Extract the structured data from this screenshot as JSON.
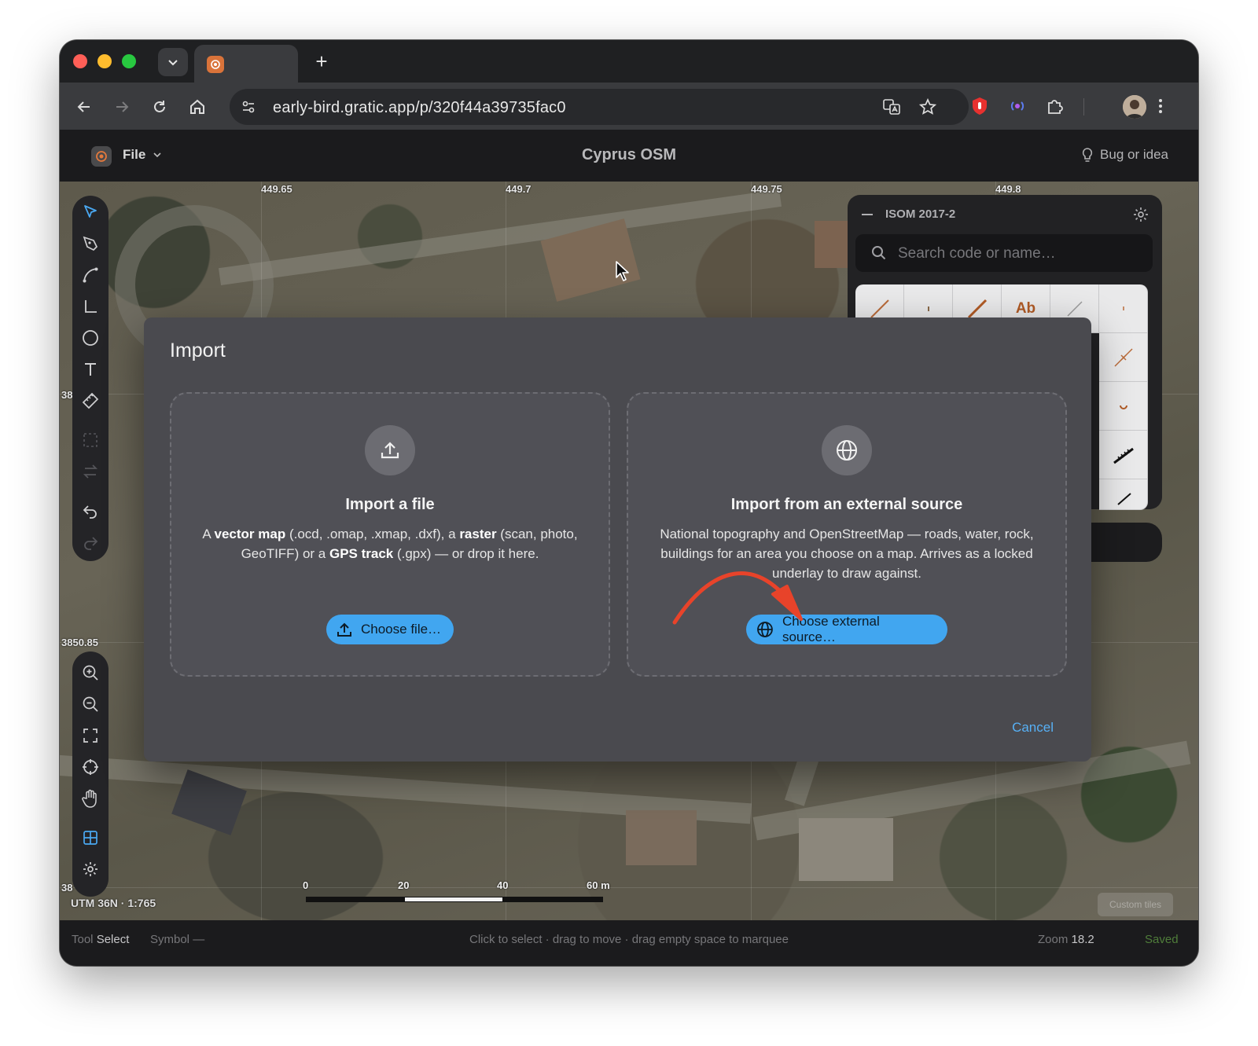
{
  "browser": {
    "url": "early-bird.gratic.app/p/320f44a39735fac0"
  },
  "app": {
    "file_menu": "File",
    "doc_title": "Cyprus OSM",
    "bug_link": "Bug or idea"
  },
  "map": {
    "coords_top": [
      "449.65",
      "449.7",
      "449.75",
      "449.8"
    ],
    "coord_left_1": "38",
    "coord_left_2": "3850.85",
    "coord_left_3": "38",
    "projection": "UTM 36N · 1:765",
    "scale_labels": [
      "0",
      "20",
      "40",
      "60 m"
    ],
    "custom_chip": "Custom tiles"
  },
  "palette": {
    "title": "ISOM 2017-2",
    "search_placeholder": "Search code or name…",
    "text_symbol": "Ab"
  },
  "dialog": {
    "title": "Import",
    "file_card": {
      "title": "Import a file",
      "desc_1": "A ",
      "desc_b1": "vector map",
      "desc_2": " (.ocd, .omap, .xmap, .dxf), a ",
      "desc_b2": "raster",
      "desc_3": " (scan, photo, GeoTIFF) or a ",
      "desc_b3": "GPS track",
      "desc_4": " (.gpx) — or drop it here.",
      "button": "Choose file…"
    },
    "external_card": {
      "title": "Import from an external source",
      "desc": "National topography and OpenStreetMap — roads, water, rock, buildings for an area you choose on a map. Arrives as a locked underlay to draw against.",
      "button": "Choose external source…"
    },
    "cancel": "Cancel"
  },
  "status": {
    "tool_label": "Tool",
    "tool_value": "Select",
    "symbol_label": "Symbol",
    "symbol_value": "—",
    "hint": "Click to select · drag to move · drag empty space to marquee",
    "zoom_label": "Zoom",
    "zoom_value": "18.2",
    "saved": "Saved"
  },
  "colors": {
    "accent": "#41a6f0",
    "saved": "#4f7d3a",
    "annotation_arrow": "#e8432a"
  }
}
